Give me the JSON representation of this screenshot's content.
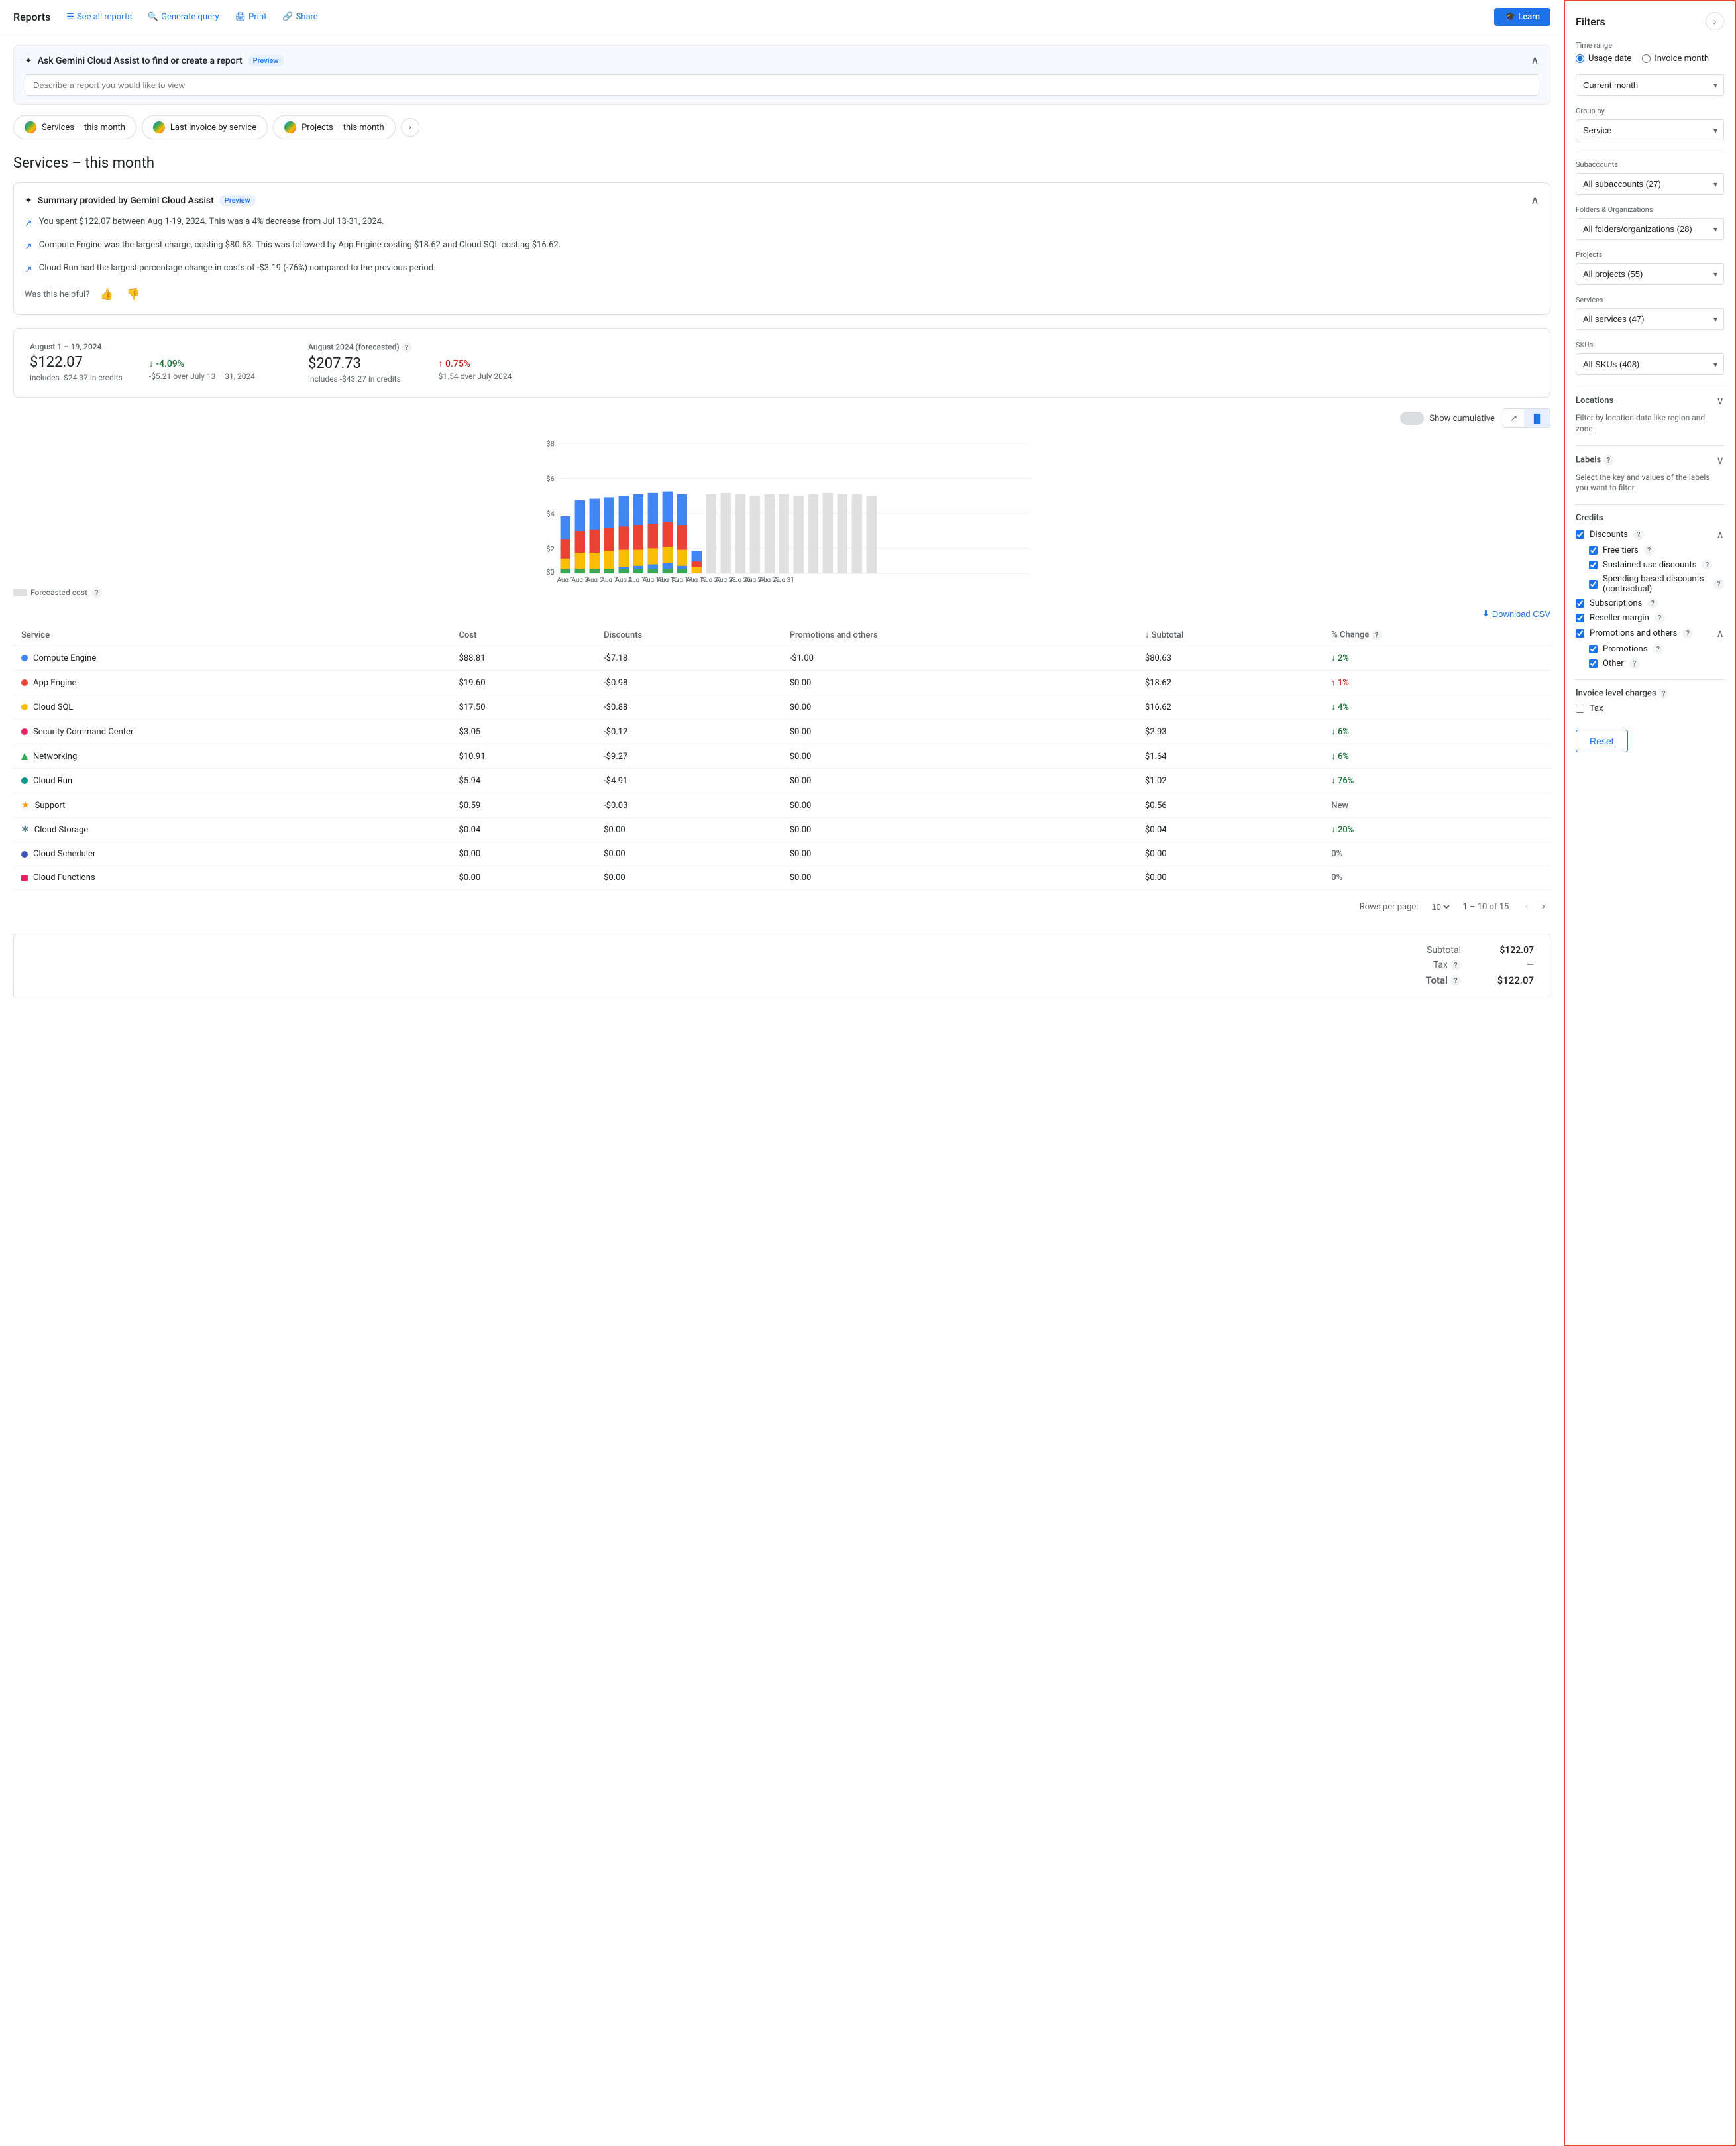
{
  "nav": {
    "brand": "Reports",
    "links": [
      {
        "label": "See all reports",
        "icon": "list-icon"
      },
      {
        "label": "Generate query",
        "icon": "search-icon"
      },
      {
        "label": "Print",
        "icon": "print-icon"
      },
      {
        "label": "Share",
        "icon": "share-icon"
      }
    ],
    "learn": "Learn"
  },
  "gemini": {
    "title": "Ask Gemini Cloud Assist to find or create a report",
    "preview_badge": "Preview",
    "placeholder": "Describe a report you would like to view"
  },
  "report_tabs": [
    {
      "label": "Services – this month"
    },
    {
      "label": "Last invoice by service"
    },
    {
      "label": "Projects – this month"
    }
  ],
  "page_title": "Services – this month",
  "summary": {
    "title": "Summary provided by Gemini Cloud Assist",
    "preview_badge": "Preview",
    "items": [
      "You spent $122.07 between Aug 1-19, 2024. This was a 4% decrease from Jul 13-31, 2024.",
      "Compute Engine was the largest charge, costing $80.63. This was followed by App Engine costing $18.62 and Cloud SQL costing $16.62.",
      "Cloud Run had the largest percentage change in costs of -$3.19 (-76%) compared to the previous period."
    ],
    "feedback_label": "Was this helpful?"
  },
  "metrics": {
    "period1": {
      "label": "August 1 – 19, 2024",
      "value": "$122.07",
      "sub": "includes -$24.37 in credits"
    },
    "period1_change": {
      "value": "↓ -4.09%",
      "sub": "-$5.21 over July 13 – 31, 2024",
      "type": "down"
    },
    "period2": {
      "label": "August 2024 (forecasted)",
      "value": "$207.73",
      "sub": "includes -$43.27 in credits"
    },
    "period2_change": {
      "value": "↑ 0.75%",
      "sub": "$1.54 over July 2024",
      "type": "up"
    }
  },
  "chart": {
    "y_labels": [
      "$8",
      "$6",
      "$4",
      "$2",
      "$0"
    ],
    "x_labels": [
      "Aug 1",
      "Aug 3",
      "Aug 5",
      "Aug 7",
      "Aug 9",
      "Aug 11",
      "Aug 13",
      "Aug 15",
      "Aug 17",
      "Aug 19",
      "Aug 21",
      "Aug 23",
      "Aug 25",
      "Aug 27",
      "Aug 29",
      "Aug 31"
    ],
    "show_cumulative": "Show cumulative",
    "forecast_legend": "Forecasted cost"
  },
  "table": {
    "download_btn": "Download CSV",
    "columns": [
      "Service",
      "Cost",
      "Discounts",
      "Promotions and others",
      "Subtotal",
      "% Change"
    ],
    "rows": [
      {
        "service": "Compute Engine",
        "cost": "$88.81",
        "discounts": "-$7.18",
        "promos": "-$1.00",
        "subtotal": "$80.63",
        "change": "2%",
        "change_type": "down",
        "dot": "blue"
      },
      {
        "service": "App Engine",
        "cost": "$19.60",
        "discounts": "-$0.98",
        "promos": "$0.00",
        "subtotal": "$18.62",
        "change": "1%",
        "change_type": "up",
        "dot": "orange"
      },
      {
        "service": "Cloud SQL",
        "cost": "$17.50",
        "discounts": "-$0.88",
        "promos": "$0.00",
        "subtotal": "$16.62",
        "change": "4%",
        "change_type": "down",
        "dot": "yellow"
      },
      {
        "service": "Security Command Center",
        "cost": "$3.05",
        "discounts": "-$0.12",
        "promos": "$0.00",
        "subtotal": "$2.93",
        "change": "6%",
        "change_type": "down",
        "dot": "red"
      },
      {
        "service": "Networking",
        "cost": "$10.91",
        "discounts": "-$9.27",
        "promos": "$0.00",
        "subtotal": "$1.64",
        "change": "6%",
        "change_type": "down",
        "dot": "triangle"
      },
      {
        "service": "Cloud Run",
        "cost": "$5.94",
        "discounts": "-$4.91",
        "promos": "$0.00",
        "subtotal": "$1.02",
        "change": "76%",
        "change_type": "down",
        "dot": "teal"
      },
      {
        "service": "Support",
        "cost": "$0.59",
        "discounts": "-$0.03",
        "promos": "$0.00",
        "subtotal": "$0.56",
        "change": "New",
        "change_type": "neutral",
        "dot": "star"
      },
      {
        "service": "Cloud Storage",
        "cost": "$0.04",
        "discounts": "$0.00",
        "promos": "$0.00",
        "subtotal": "$0.04",
        "change": "20%",
        "change_type": "down",
        "dot": "asterisk"
      },
      {
        "service": "Cloud Scheduler",
        "cost": "$0.00",
        "discounts": "$0.00",
        "promos": "$0.00",
        "subtotal": "$0.00",
        "change": "0%",
        "change_type": "neutral",
        "dot": "navy"
      },
      {
        "service": "Cloud Functions",
        "cost": "$0.00",
        "discounts": "$0.00",
        "promos": "$0.00",
        "subtotal": "$0.00",
        "change": "0%",
        "change_type": "neutral",
        "dot": "pink"
      }
    ],
    "pagination": {
      "rows_per_page": "10",
      "range": "1 – 10 of 15"
    }
  },
  "totals": {
    "subtotal_label": "Subtotal",
    "subtotal_value": "$122.07",
    "tax_label": "Tax",
    "tax_value": "—",
    "total_label": "Total",
    "total_value": "$122.07"
  },
  "filters": {
    "title": "Filters",
    "time_range": {
      "label": "Time range",
      "options": [
        {
          "label": "Usage date",
          "selected": true
        },
        {
          "label": "Invoice month",
          "selected": false
        }
      ]
    },
    "period": {
      "value": "Current month"
    },
    "group_by": {
      "label": "Group by",
      "value": "Service"
    },
    "subaccounts": {
      "label": "Subaccounts",
      "value": "All subaccounts (27)"
    },
    "folders": {
      "label": "Folders & Organizations",
      "value": "All folders/organizations (28)"
    },
    "projects": {
      "label": "Projects",
      "value": "All projects (55)"
    },
    "services": {
      "label": "Services",
      "value": "All services (47)"
    },
    "skus": {
      "label": "SKUs",
      "value": "All SKUs (408)"
    },
    "locations": {
      "label": "Locations",
      "desc": "Filter by location data like region and zone."
    },
    "labels": {
      "label": "Labels",
      "desc": "Select the key and values of the labels you want to filter."
    },
    "credits": {
      "label": "Credits",
      "discounts": {
        "label": "Discounts",
        "checked": true,
        "children": [
          {
            "label": "Free tiers",
            "checked": true
          },
          {
            "label": "Sustained use discounts",
            "checked": true
          },
          {
            "label": "Spending based discounts (contractual)",
            "checked": true
          }
        ]
      },
      "subscriptions": {
        "label": "Subscriptions",
        "checked": true
      },
      "reseller_margin": {
        "label": "Reseller margin",
        "checked": true
      },
      "promotions_and_others": {
        "label": "Promotions and others",
        "checked": true,
        "children": [
          {
            "label": "Promotions",
            "checked": true
          },
          {
            "label": "Other",
            "checked": true
          }
        ]
      }
    },
    "invoice_charges": {
      "label": "Invoice level charges",
      "tax": {
        "label": "Tax",
        "checked": false
      }
    },
    "reset_btn": "Reset"
  }
}
